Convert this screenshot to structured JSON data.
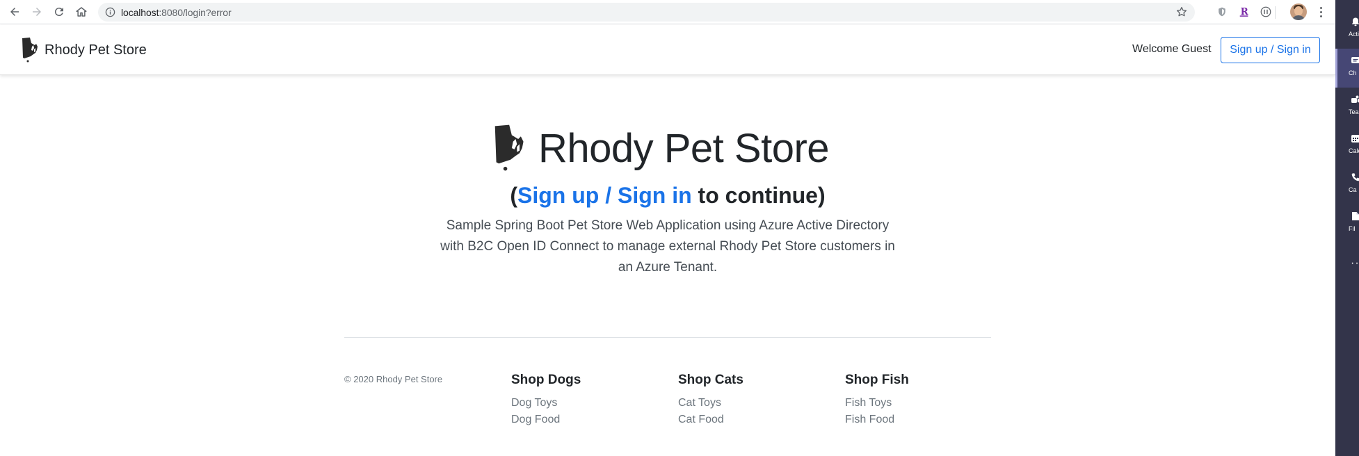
{
  "browser": {
    "url_host": "localhost",
    "url_path": ":8080/login?error"
  },
  "navbar": {
    "brand": "Rhody Pet Store",
    "welcome": "Welcome Guest",
    "signin_button": "Sign up / Sign in"
  },
  "hero": {
    "title": "Rhody Pet Store",
    "cta_open": "(",
    "cta_link": "Sign up / Sign in",
    "cta_rest": " to continue)",
    "lead": "Sample Spring Boot Pet Store Web Application using Azure Active Directory with B2C Open ID Connect to manage external Rhody Pet Store customers in an Azure Tenant."
  },
  "footer": {
    "copyright": "© 2020 Rhody Pet Store",
    "columns": [
      {
        "heading": "Shop Dogs",
        "links": [
          "Dog Toys",
          "Dog Food"
        ]
      },
      {
        "heading": "Shop Cats",
        "links": [
          "Cat Toys",
          "Cat Food"
        ]
      },
      {
        "heading": "Shop Fish",
        "links": [
          "Fish Toys",
          "Fish Food"
        ]
      }
    ]
  },
  "teams_rail": {
    "items": [
      "Acti",
      "Ch",
      "Tea",
      "Cale",
      "Ca",
      "Fil"
    ]
  },
  "colors": {
    "link": "#1a73e8",
    "rail_bg": "#33344a",
    "rail_active": "#464775"
  },
  "icons": [
    "back-icon",
    "forward-icon",
    "reload-icon",
    "home-icon",
    "info-icon",
    "star-icon",
    "rhode-island-logo-icon"
  ]
}
